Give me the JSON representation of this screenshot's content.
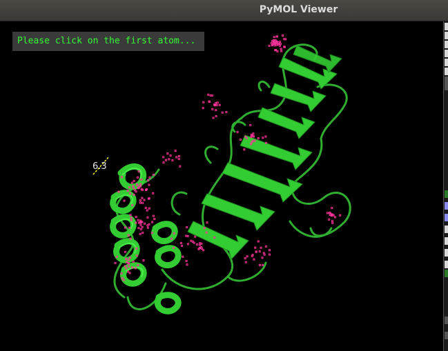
{
  "window": {
    "title": "PyMOL Viewer"
  },
  "viewer": {
    "prompt": "Please click on the first atom...",
    "distance_label": "6.3",
    "background_color": "#000000",
    "cartoon_color": "#33cc33",
    "cartoon_highlight": "#55ff55",
    "dot_color": "#ff3399",
    "prompt_color": "#33ff33",
    "dash_color": "#ffff33"
  }
}
